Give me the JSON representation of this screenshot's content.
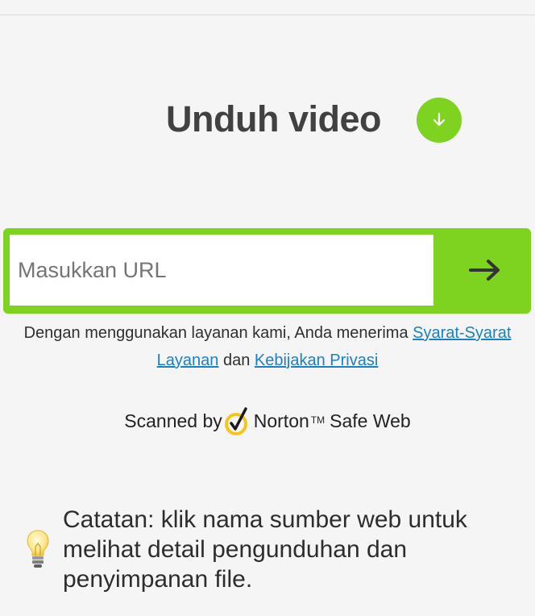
{
  "header": {
    "title": "Unduh video"
  },
  "url_form": {
    "placeholder": "Masukkan URL",
    "value": ""
  },
  "terms": {
    "prefix": "Dengan menggunakan layanan kami, Anda menerima ",
    "tos_link": "Syarat-Syarat Layanan",
    "middle": " dan ",
    "privacy_link": "Kebijakan Privasi"
  },
  "norton": {
    "prefix": "Scanned by",
    "brand": "Norton",
    "tm": "TM",
    "suffix": "Safe Web"
  },
  "note": {
    "text": "Catatan: klik nama sumber web untuk melihat detail pengunduhan dan penyimpanan file."
  },
  "colors": {
    "accent_green": "#7ed321",
    "link_blue": "#1d7fc4",
    "norton_yellow": "#f5c518"
  },
  "icons": {
    "download": "download-arrow-icon",
    "submit": "arrow-right-icon",
    "norton": "norton-check-icon",
    "note": "lightbulb-icon"
  }
}
